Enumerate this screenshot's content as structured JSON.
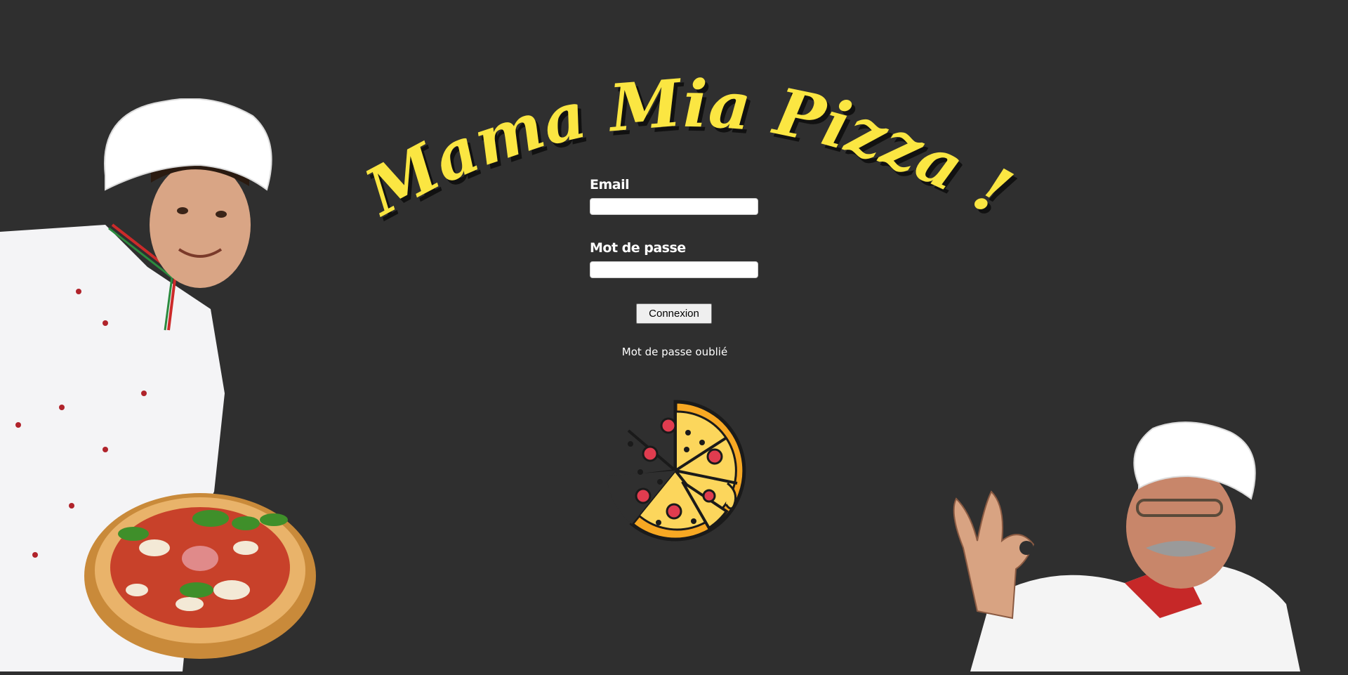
{
  "app": {
    "title": "Mama Mia Pizza !"
  },
  "form": {
    "email_label": "Email",
    "email_value": "",
    "password_label": "Mot de passe",
    "password_value": "",
    "submit_label": "Connexion",
    "forgot_label": "Mot de passe oublié"
  },
  "colors": {
    "background": "#2f2f2f",
    "title": "#fbe642",
    "pizza_crust": "#f7a823",
    "pizza_cheese": "#fcd65c",
    "pepperoni": "#e03c4f"
  },
  "images": {
    "left": "chef-with-pizza",
    "center": "pizza-icon",
    "right": "chef-ok-gesture"
  }
}
